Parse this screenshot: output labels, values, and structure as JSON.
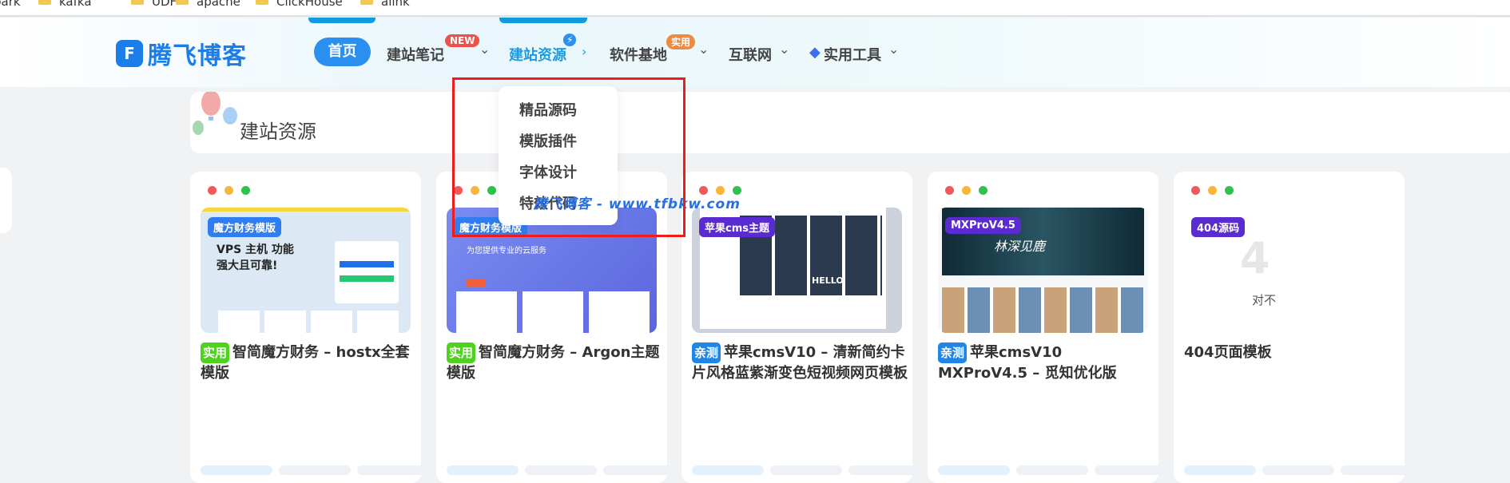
{
  "bookmarks": [
    "park",
    "kafka",
    "UDF",
    "apache",
    "ClickHouse",
    "alink"
  ],
  "logo": {
    "mark": "F",
    "text": "腾飞博客"
  },
  "nav": {
    "home": "首页",
    "items": [
      {
        "label": "建站笔记",
        "badge": "NEW"
      },
      {
        "label": "建站资源",
        "badge": "⚡"
      },
      {
        "label": "软件基地",
        "badge": "实用"
      },
      {
        "label": "互联网"
      },
      {
        "label": "实用工具"
      }
    ]
  },
  "dropdown": [
    "精品源码",
    "模版插件",
    "字体设计",
    "特效代码"
  ],
  "watermark": "腾飞博客 - www.tfbkw.com",
  "section_title": "建站资源",
  "cards": [
    {
      "thumb_badge": "魔方财务模版",
      "tag": "实用",
      "title": "智简魔方财务 – hostx全套模版",
      "thumb_text": "VPS 主机 功能强大且可靠!"
    },
    {
      "thumb_badge": "魔方财务模版",
      "tag": "实用",
      "title": "智简魔方财务 – Argon主题模版",
      "thumb_text": "为您提供专业的云服务"
    },
    {
      "thumb_badge": "苹果cms主题",
      "tag": "亲测",
      "title": "苹果cmsV10 – 清新简约卡片风格蓝紫渐变色短视频网页模板",
      "thumb_text": "HELLO"
    },
    {
      "thumb_badge": "MXProV4.5",
      "tag": "亲测",
      "title": "苹果cmsV10 MXProV4.5 – 觅知优化版",
      "thumb_text": "林深见鹿"
    },
    {
      "thumb_badge": "404源码",
      "tag": "",
      "title": "404页面模板",
      "thumb_text": "对不"
    }
  ]
}
